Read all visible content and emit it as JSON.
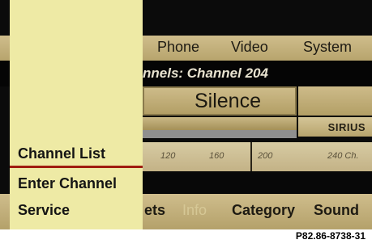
{
  "top_menu": {
    "phone": "Phone",
    "video": "Video",
    "system": "System"
  },
  "status": {
    "text": "nnels: Channel 204"
  },
  "track": {
    "title": "Silence"
  },
  "logo": {
    "text": "SIRIUS"
  },
  "scale": {
    "ticks": [
      "120",
      "160",
      "200",
      "240 Ch."
    ]
  },
  "side_menu": {
    "items": [
      "Channel List",
      "Enter Channel",
      "Service"
    ],
    "selected": "Channel List"
  },
  "bottom_menu": {
    "presets": "ets",
    "info": "Info",
    "category": "Category",
    "sound": "Sound"
  },
  "caption": "P82.86-8738-31",
  "colors": {
    "menu_bg": "#eeeaa5",
    "bar_tan": "#cfbd8c",
    "highlight_line": "#a01c10"
  }
}
